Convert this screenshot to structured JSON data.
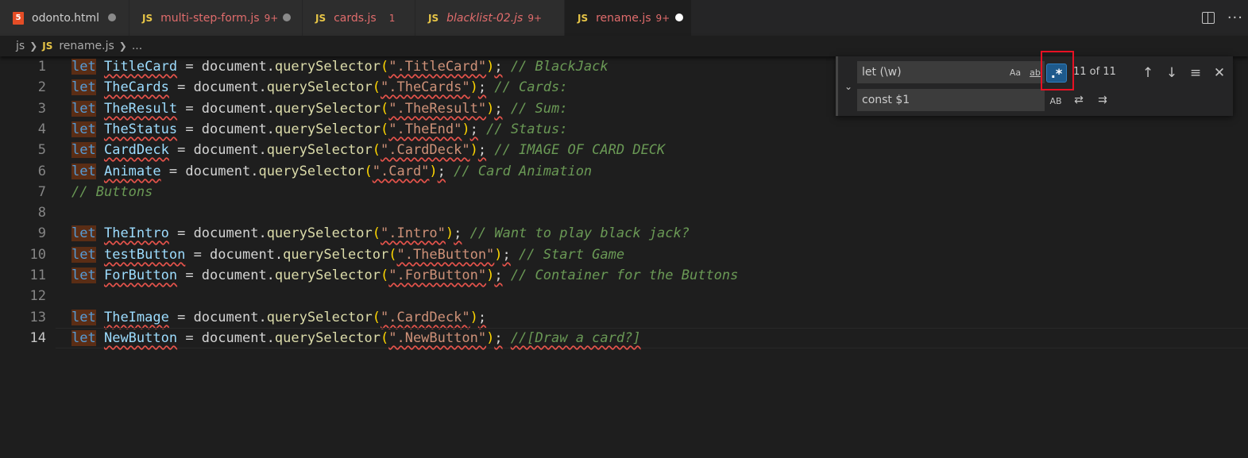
{
  "tabs": [
    {
      "icon": "5",
      "name": "odonto.html",
      "badge": "",
      "modified": true,
      "active": false
    },
    {
      "icon": "JS",
      "name": "multi-step-form.js",
      "badge": "9+",
      "modified": true,
      "active": false
    },
    {
      "icon": "JS",
      "name": "cards.js",
      "badge": "1",
      "modified": false,
      "active": false
    },
    {
      "icon": "JS",
      "name": "blacklist-02.js",
      "badge": "9+",
      "modified": false,
      "active": false
    },
    {
      "icon": "JS",
      "name": "rename.js",
      "badge": "9+",
      "modified": true,
      "active": true
    }
  ],
  "breadcrumb": {
    "folder": "js",
    "icon": "JS",
    "file": "rename.js",
    "more": "..."
  },
  "find": {
    "search_value": "let (\\w)",
    "replace_value": "const $1",
    "match_case": "Aa",
    "whole_word": "ab",
    "regex": ".*",
    "preserve_case": "AB",
    "count": "11 of 11",
    "prev_icon": "↑",
    "next_icon": "↓",
    "selection_icon": "≡",
    "close_icon": "✕",
    "replace_one_icon": "⇄",
    "replace_all_icon": "⇉",
    "toggle_icon": "⌄"
  },
  "code": {
    "lines": [
      {
        "n": "1",
        "kw": "let",
        "name": "TitleCard",
        "mid": " = document.",
        "fn": "querySelector",
        "str": "\".TitleCard\"",
        "cmt": "// BlackJack",
        "type": "decl"
      },
      {
        "n": "2",
        "kw": "let",
        "name": "TheCards",
        "mid": " = document.",
        "fn": "querySelector",
        "str": "\".TheCards\"",
        "cmt": "// Cards:",
        "type": "decl"
      },
      {
        "n": "3",
        "kw": "let",
        "name": "TheResult",
        "mid": " = document.",
        "fn": "querySelector",
        "str": "\".TheResult\"",
        "cmt": "// Sum:",
        "type": "decl"
      },
      {
        "n": "4",
        "kw": "let",
        "name": "TheStatus",
        "mid": " = document.",
        "fn": "querySelector",
        "str": "\".TheEnd\"",
        "cmt": "// Status:",
        "type": "decl"
      },
      {
        "n": "5",
        "kw": "let",
        "name": "CardDeck",
        "mid": " = document.",
        "fn": "querySelector",
        "str": "\".CardDeck\"",
        "cmt": "// IMAGE OF CARD DECK",
        "type": "decl"
      },
      {
        "n": "6",
        "kw": "let",
        "name": "Animate",
        "mid": " = document.",
        "fn": "querySelector",
        "str": "\".Card\"",
        "cmt": "// Card Animation",
        "type": "decl"
      },
      {
        "n": "7",
        "cmt": "// Buttons",
        "type": "comment"
      },
      {
        "n": "8",
        "type": "empty"
      },
      {
        "n": "9",
        "kw": "let",
        "name": "TheIntro",
        "mid": " = document.",
        "fn": "querySelector",
        "str": "\".Intro\"",
        "cmt": "// Want to play black jack?",
        "type": "decl"
      },
      {
        "n": "10",
        "kw": "let",
        "name": "testButton",
        "mid": " = document.",
        "fn": "querySelector",
        "str": "\".TheButton\"",
        "cmt": "// Start Game",
        "type": "decl"
      },
      {
        "n": "11",
        "kw": "let",
        "name": "ForButton",
        "mid": " = document.",
        "fn": "querySelector",
        "str": "\".ForButton\"",
        "cmt": "// Container for the Buttons",
        "type": "decl"
      },
      {
        "n": "12",
        "type": "empty"
      },
      {
        "n": "13",
        "kw": "let",
        "name": "TheImage",
        "mid": " = document.",
        "fn": "querySelector",
        "str": "\".CardDeck\"",
        "cmt": "",
        "type": "decl"
      },
      {
        "n": "14",
        "kw": "let",
        "name": "NewButton",
        "mid": " = document.",
        "fn": "querySelector",
        "str": "\".NewButton\"",
        "cmt": "//[Draw a card?]",
        "type": "decl"
      }
    ]
  },
  "colors": {
    "accent": "#1e5a8c",
    "highlight_box": "#e81123",
    "editor_bg": "#1e1e1e"
  }
}
